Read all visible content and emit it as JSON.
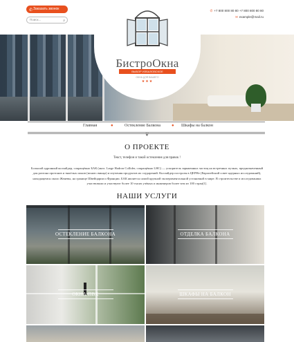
{
  "header": {
    "callback_label": "Заказать звонок",
    "search_placeholder": "Поиск...",
    "phones": "+7 800 800 80 80   +7 800 800 80 80",
    "email": "example@mail.ru"
  },
  "logo": {
    "brand": "БистроОкна",
    "slogan": "ВЫБОР ИЗБАЛОВСКОЕ",
    "small_text": "ОКНА ДЛЯ ВАШЕГО",
    "stars": "★★★"
  },
  "nav": {
    "items": [
      "Главная",
      "Остекление Балкона",
      "Шкафы на балкон"
    ]
  },
  "about": {
    "title": "О ПРОЕКТЕ",
    "subtitle": "Текст, телефон и такой остекление для правок !",
    "body": "Большой адронный коллайдер, сокращённо БАК (англ. Large Hadron Collider, сокращённо LHC) — ускоритель заряженных частиц на встречных пучках, предназначенный для разгона протонов и тяжёлых ионов (ионов свинца) и изучения продуктов их соударений. Коллайдер построен в ЦЕРНе (Европейский совет ядерных исследований), находящемся около Женевы, на границе Швейцарии и Франции. БАК является самой крупной экспериментальной установкой в мире. В строительстве и исследованиях участвовали и участвуют более 10 тысяч учёных и инженеров более чем из 100 стран[1]."
  },
  "services": {
    "title": "НАШИ УСЛУГИ",
    "tiles": [
      {
        "label": "ОСТЕКЛЕНИЕ БАЛКОНА"
      },
      {
        "label": "ОТДЕЛКА БАЛКОНА"
      },
      {
        "label": "ОКНА ПВХ"
      },
      {
        "label": "ШКАФЫ НА БАЛКОН"
      }
    ]
  },
  "colors": {
    "accent": "#e8501e"
  }
}
